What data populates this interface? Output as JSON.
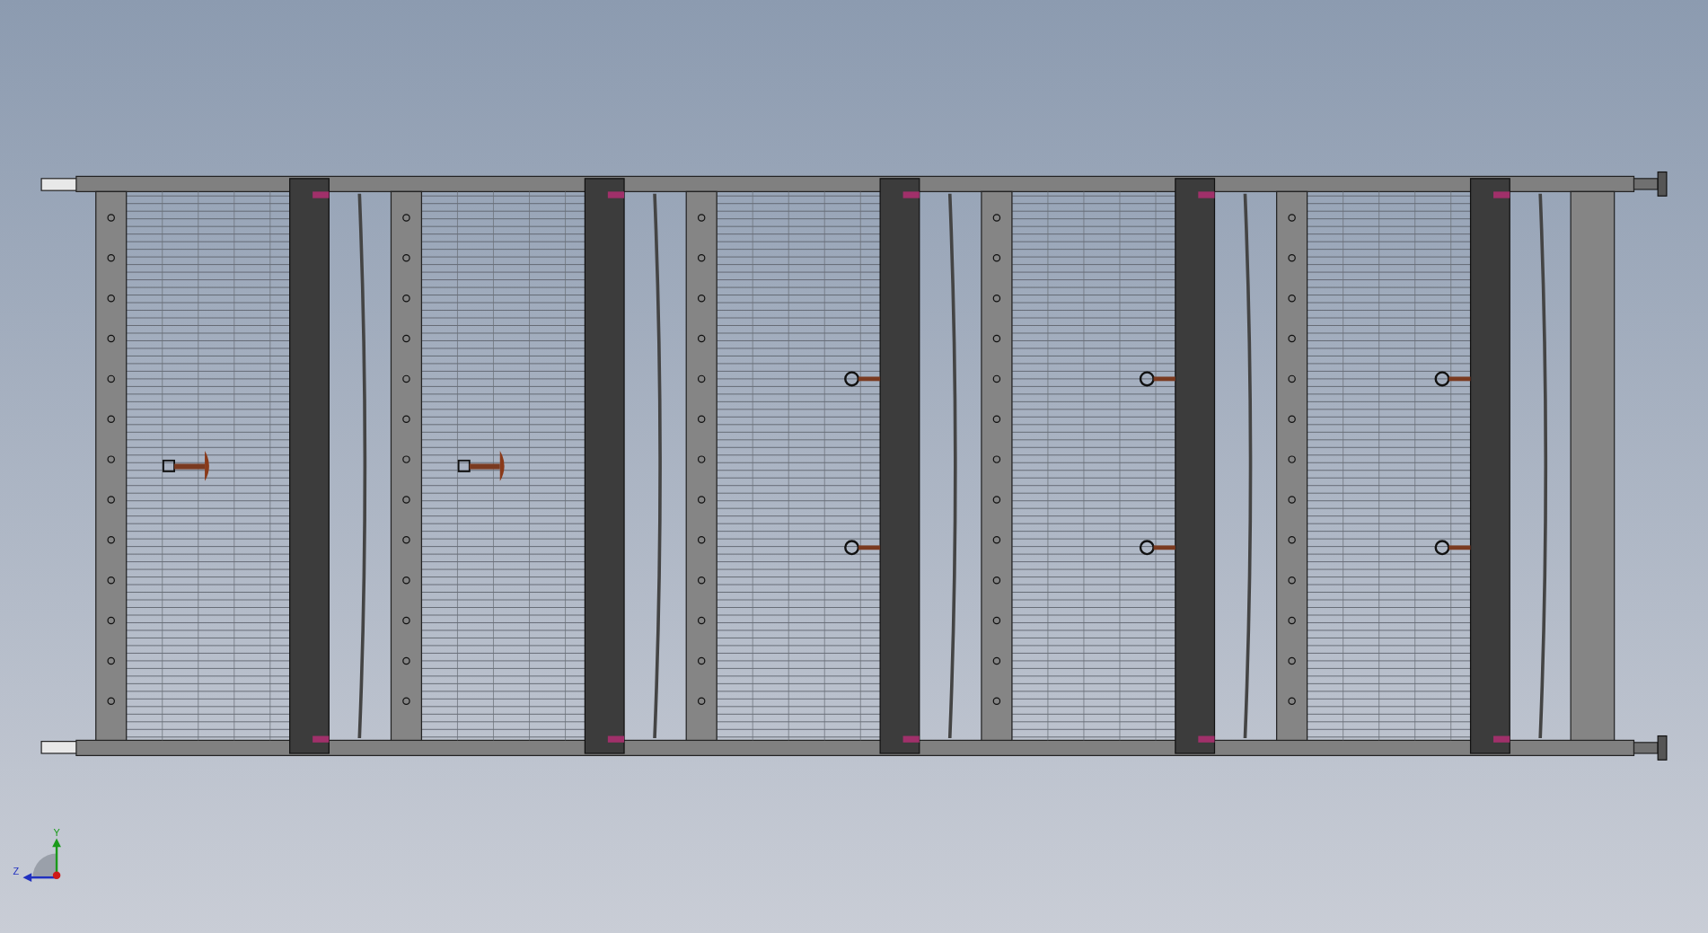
{
  "viewport": {
    "triad": {
      "axes": [
        {
          "label": "Y",
          "kind": "y"
        },
        {
          "label": "Z",
          "kind": "z"
        }
      ]
    }
  }
}
